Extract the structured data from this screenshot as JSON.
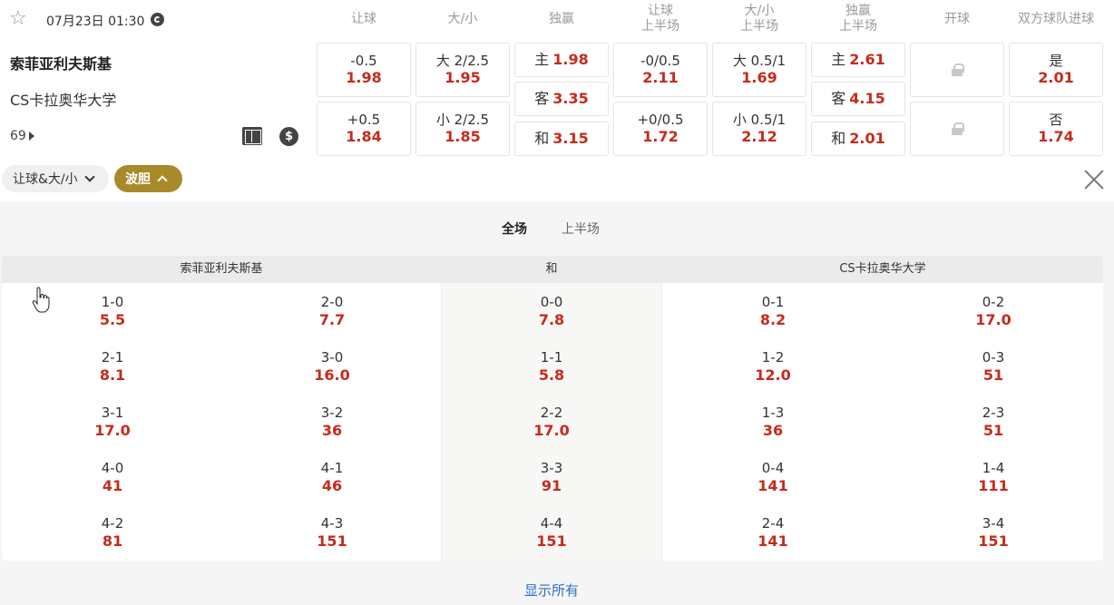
{
  "match": {
    "datetime": "07月23日 01:30",
    "home": "索菲亚利夫斯基",
    "away": "CS卡拉奥华大学",
    "more_count": "69"
  },
  "headers": [
    "让球",
    "大/小",
    "独赢",
    "让球\n上半场",
    "大/小\n上半场",
    "独赢\n上半场",
    "开球",
    "双方球队进球"
  ],
  "markets": {
    "handicap": [
      {
        "label": "-0.5",
        "odd": "1.98"
      },
      {
        "label": "+0.5",
        "odd": "1.84"
      }
    ],
    "overunder": [
      {
        "label": "大 2/2.5",
        "odd": "1.95"
      },
      {
        "label": "小 2/2.5",
        "odd": "1.85"
      }
    ],
    "moneyline": [
      {
        "label": "主",
        "odd": "1.98"
      },
      {
        "label": "客",
        "odd": "3.35"
      },
      {
        "label": "和",
        "odd": "3.15"
      }
    ],
    "handicap_1h": [
      {
        "label": "-0/0.5",
        "odd": "2.11"
      },
      {
        "label": "+0/0.5",
        "odd": "1.72"
      }
    ],
    "overunder_1h": [
      {
        "label": "大 0.5/1",
        "odd": "1.69"
      },
      {
        "label": "小 0.5/1",
        "odd": "2.12"
      }
    ],
    "moneyline_1h": [
      {
        "label": "主",
        "odd": "2.61"
      },
      {
        "label": "客",
        "odd": "4.15"
      },
      {
        "label": "和",
        "odd": "2.01"
      }
    ],
    "btts": [
      {
        "label": "是",
        "odd": "2.01"
      },
      {
        "label": "否",
        "odd": "1.74"
      }
    ]
  },
  "filters": {
    "market_select": "让球&大/小",
    "active_tab": "波胆"
  },
  "period_tabs": [
    "全场",
    "上半场"
  ],
  "correct_score": {
    "headers": {
      "home": "索菲亚利夫斯基",
      "draw": "和",
      "away": "CS卡拉奥华大学"
    },
    "home_col1": [
      [
        "1-0",
        "5.5"
      ],
      [
        "2-1",
        "8.1"
      ],
      [
        "3-1",
        "17.0"
      ],
      [
        "4-0",
        "41"
      ],
      [
        "4-2",
        "81"
      ]
    ],
    "home_col2": [
      [
        "2-0",
        "7.7"
      ],
      [
        "3-0",
        "16.0"
      ],
      [
        "3-2",
        "36"
      ],
      [
        "4-1",
        "46"
      ],
      [
        "4-3",
        "151"
      ]
    ],
    "draw": [
      [
        "0-0",
        "7.8"
      ],
      [
        "1-1",
        "5.8"
      ],
      [
        "2-2",
        "17.0"
      ],
      [
        "3-3",
        "91"
      ],
      [
        "4-4",
        "151"
      ]
    ],
    "away_col1": [
      [
        "0-1",
        "8.2"
      ],
      [
        "1-2",
        "12.0"
      ],
      [
        "1-3",
        "36"
      ],
      [
        "0-4",
        "141"
      ],
      [
        "2-4",
        "141"
      ]
    ],
    "away_col2": [
      [
        "0-2",
        "17.0"
      ],
      [
        "0-3",
        "51"
      ],
      [
        "2-3",
        "51"
      ],
      [
        "1-4",
        "111"
      ],
      [
        "3-4",
        "151"
      ]
    ]
  },
  "show_all": "显示所有",
  "colors": {
    "odd": "#c62a1c",
    "accent": "#a98a2b",
    "link": "#2b6ec4"
  }
}
